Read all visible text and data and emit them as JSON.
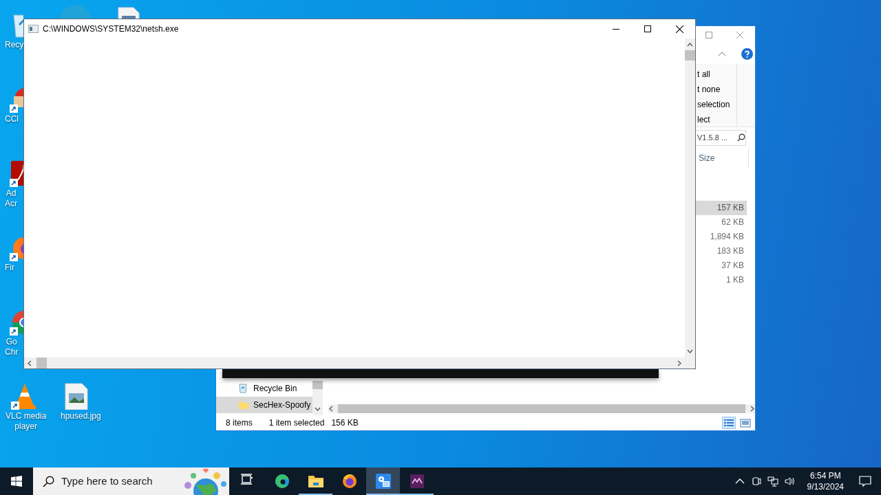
{
  "desktop_icons": [
    {
      "kind": "recycle-bin",
      "lines": [
        "Recy"
      ]
    },
    {
      "kind": "edge"
    },
    {
      "kind": "document"
    },
    {
      "kind": "ccleaner",
      "lines": [
        "CCl"
      ]
    },
    {
      "kind": "acrobat",
      "lines": [
        "Ad",
        "Acr"
      ]
    },
    {
      "kind": "firefox",
      "lines": [
        "Fir"
      ]
    },
    {
      "kind": "chrome",
      "lines": [
        "Go",
        "Chr"
      ]
    },
    {
      "kind": "vlc",
      "lines": [
        "VLC media",
        "player"
      ]
    },
    {
      "kind": "image",
      "lines": [
        "hpused.jpg"
      ]
    }
  ],
  "explorer": {
    "ribbon_items": [
      "t all",
      "t none",
      "selection",
      "lect"
    ],
    "search": {
      "value": "V1.5.8 ..."
    },
    "columns": [
      "Size"
    ],
    "files": [
      {
        "size": "157 KB",
        "selected": true
      },
      {
        "size": "62 KB",
        "selected": false
      },
      {
        "size": "1,894 KB",
        "selected": false
      },
      {
        "size": "183 KB",
        "selected": false
      },
      {
        "size": "37 KB",
        "selected": false
      },
      {
        "size": "1 KB",
        "selected": false
      }
    ],
    "nav_items": [
      {
        "kind": "recycle-bin",
        "label": "Recycle Bin",
        "selected": false
      },
      {
        "kind": "folder",
        "label": "SecHex-Spoofy",
        "selected": true
      }
    ],
    "status": {
      "items": "8 items",
      "selection": "1 item selected",
      "size": "156 KB"
    },
    "view_buttons": [
      {
        "kind": "details",
        "selected": true
      },
      {
        "kind": "large-icons",
        "selected": false
      }
    ]
  },
  "console": {
    "title": "C:\\WINDOWS\\SYSTEM32\\netsh.exe"
  },
  "taskbar": {
    "search": {
      "placeholder": "Type here to search"
    },
    "apps": [
      {
        "kind": "task-view",
        "running": false,
        "selected": false
      },
      {
        "kind": "edge",
        "running": false,
        "selected": false
      },
      {
        "kind": "file-explorer",
        "running": true,
        "selected": false
      },
      {
        "kind": "firefox",
        "running": false,
        "selected": false
      },
      {
        "kind": "settings-window",
        "running": true,
        "selected": true
      },
      {
        "kind": "purple-app",
        "running": true,
        "selected": false
      }
    ],
    "tray": {
      "time": "6:54 PM",
      "date": "9/13/2024"
    }
  }
}
